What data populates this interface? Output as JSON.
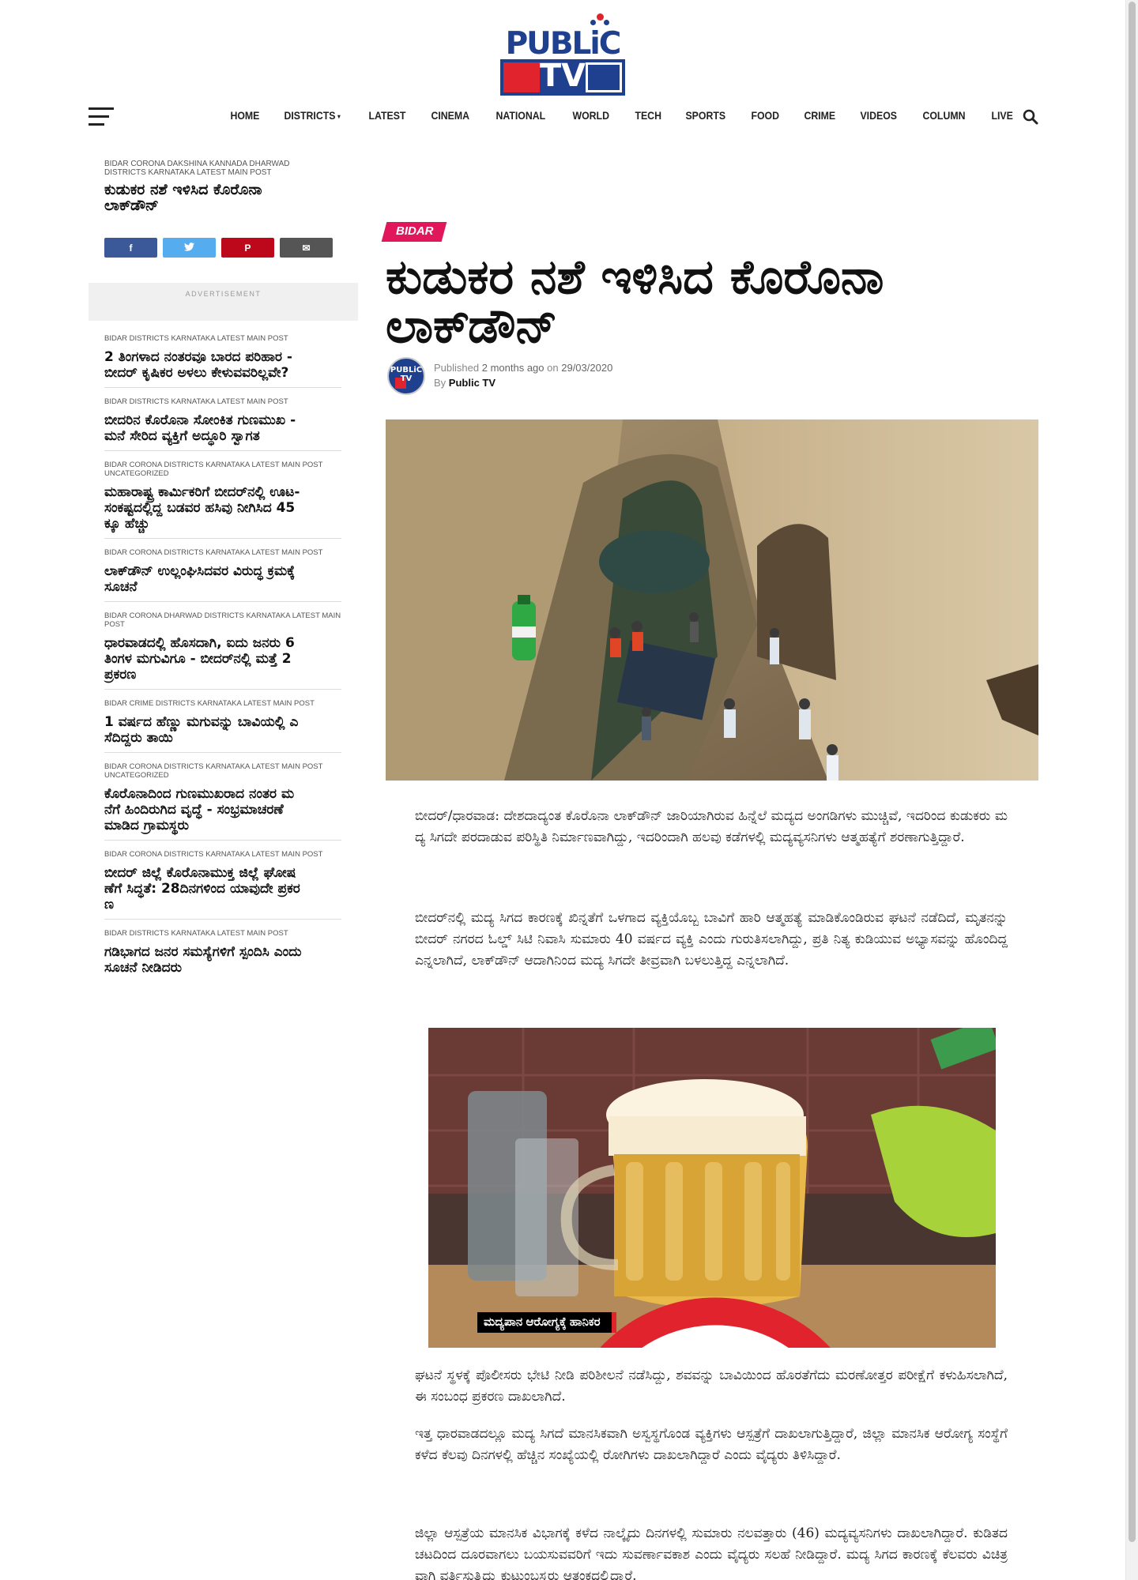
{
  "brand": {
    "logo_line1": "PUBLiC",
    "logo_line2": "TV",
    "colors": {
      "blue": "#1f3f8f",
      "red": "#e0232c",
      "accent_pink": "#e0175b"
    }
  },
  "nav": {
    "items": [
      "HOME",
      "DISTRICTS",
      "LATEST",
      "CINEMA",
      "NATIONAL",
      "WORLD",
      "TECH",
      "SPORTS",
      "FOOD",
      "CRIME",
      "VIDEOS",
      "COLUMN",
      "LIVE"
    ],
    "dropdown_indicator": "▾",
    "menu_icon": "hamburger-icon",
    "search_icon": "search-icon"
  },
  "sidebar": {
    "top_post": {
      "categories": "BIDAR CORONA DAKSHINA KANNADA DHARWAD DISTRICTS KARNATAKA LATEST MAIN POST",
      "title": "ಕುಡುಕರ ನಶೆ ಇಳಿಸಿದ ಕೊರೊನಾ ಲಾಕ್‍ಡೌನ್"
    },
    "share_buttons": [
      {
        "icon": "facebook-icon",
        "glyph": "f",
        "color": "#3b5998"
      },
      {
        "icon": "twitter-icon",
        "glyph": "🐦",
        "color": "#55acee"
      },
      {
        "icon": "pinterest-icon",
        "glyph": "P",
        "color": "#bd081c"
      },
      {
        "icon": "email-icon",
        "glyph": "✉",
        "color": "#555555"
      }
    ],
    "ad_label": "ADVERTISEMENT",
    "posts": [
      {
        "categories": "BIDAR DISTRICTS KARNATAKA LATEST MAIN POST",
        "title": "2 ತಿಂಗಳಾದ ನಂತರವೂ ಬಾರದ ಪರಿಹಾರ - ಬೀದರ್ ಕೃಷಿಕರ ಅಳಲು ಕೇಳುವವರಿಲ್ಲವೇ?"
      },
      {
        "categories": "BIDAR DISTRICTS KARNATAKA LATEST MAIN POST",
        "title": "ಬೀದರಿನ ಕೊರೊನಾ ಸೋಂಕಿತ ಗುಣಮುಖ - ಮನೆ ಸೇರಿದ ವ್ಯಕ್ತಿಗೆ ಅದ್ಧೂರಿ ಸ್ವಾಗತ"
      },
      {
        "categories": "BIDAR CORONA DISTRICTS KARNATAKA LATEST MAIN POST UNCATEGORIZED",
        "title": "ಮಹಾರಾಷ್ಟ್ರ ಕಾರ್ಮಿಕರಿಗೆ ಬೀದರ್‌ನಲ್ಲಿ ಊಟ- ಸಂಕಷ್ಟದಲ್ಲಿದ್ದ ಬಡವರ ಹಸಿವು ನೀಗಿಸಿದ 45ಕ್ಕೂ ಹೆಚ್ಚು"
      },
      {
        "categories": "BIDAR CORONA DISTRICTS KARNATAKA LATEST MAIN POST",
        "title": "ಲಾಕ್‍ಡೌನ್ ಉಲ್ಲಂಘಿಸಿದವರ ವಿರುದ್ಧ ಕ್ರಮಕ್ಕೆ ಸೂಚನೆ"
      },
      {
        "categories": "BIDAR CORONA DHARWAD DISTRICTS KARNATAKA LATEST MAIN POST",
        "title": "ಧಾರವಾಡದಲ್ಲಿ ಹೊಸದಾಗಿ, ಐದು ಜನರು 6 ತಿಂಗಳ ಮಗುವಿಗೂ - ಬೀದರ್‌ನಲ್ಲಿ ಮತ್ತೆ 2 ಪ್ರಕರಣ"
      },
      {
        "categories": "BIDAR CRIME DISTRICTS KARNATAKA LATEST MAIN POST",
        "title": "1 ವರ್ಷದ ಹೆಣ್ಣು ಮಗುವನ್ನು ಬಾವಿಯಲ್ಲಿ ಎಸೆದಿದ್ದರು ತಾಯಿ"
      },
      {
        "categories": "BIDAR CORONA DISTRICTS KARNATAKA LATEST MAIN POST UNCATEGORIZED",
        "title": "ಕೊರೊನಾದಿಂದ ಗುಣಮುಖರಾದ ನಂತರ ಮನೆಗೆ ಹಿಂದಿರುಗಿದ ವೃದ್ಧೆ - ಸಂಭ್ರಮಾಚರಣೆ ಮಾಡಿದ ಗ್ರಾಮಸ್ಥರು"
      },
      {
        "categories": "BIDAR CORONA DISTRICTS KARNATAKA LATEST MAIN POST",
        "title": "ಬೀದರ್ ಜಿಲ್ಲೆ ಕೊರೊನಾಮುಕ್ತ ಜಿಲ್ಲೆ ಘೋಷಣೆಗೆ ಸಿದ್ಧತೆ: 28ದಿನಗಳಿಂದ ಯಾವುದೇ ಪ್ರಕರಣ"
      },
      {
        "categories": "BIDAR DISTRICTS KARNATAKA LATEST MAIN POST",
        "title": "ಗಡಿಭಾಗದ ಜನರ ಸಮಸ್ಯೆಗಳಿಗೆ ಸ್ಪಂದಿಸಿ ಎಂದು ಸೂಚನೆ ನೀಡಿದರು"
      }
    ]
  },
  "article": {
    "category": "BIDAR",
    "title": "ಕುಡುಕರ ನಶೆ ಇಳಿಸಿದ ಕೊರೊನಾ ಲಾಕ್‍ಡೌನ್",
    "meta": {
      "published_label": "Published",
      "published_ago": "2 months ago",
      "on_label": "on",
      "date": "29/03/2020",
      "by_label": "By",
      "author": "Public TV"
    },
    "paragraphs": [
      "ಬೀದರ್/ಧಾರವಾಡ: ದೇಶದಾದ್ಯಂತ ಕೊರೊನಾ ಲಾಕ್‍ಡೌನ್ ಜಾರಿಯಾಗಿರುವ ಹಿನ್ನೆಲೆ ಮದ್ಯದ ಅಂಗಡಿಗಳು ಮುಚ್ಚಿವೆ, ಇದರಿಂದ ಕುಡುಕರು ಮದ್ಯ ಸಿಗದೇ ಪರದಾಡುವ ಪರಿಸ್ಥಿತಿ ನಿರ್ಮಾಣವಾಗಿದ್ದು, ಇದರಿಂದಾಗಿ ಹಲವು ಕಡೆಗಳಲ್ಲಿ ಮದ್ಯವ್ಯಸನಿಗಳು ಆತ್ಮಹತ್ಯೆಗೆ ಶರಣಾಗುತ್ತಿದ್ದಾರೆ.",
      "ಬೀದರ್‌ನಲ್ಲಿ ಮದ್ಯ ಸಿಗದ ಕಾರಣಕ್ಕೆ ಖಿನ್ನತೆಗೆ ಒಳಗಾದ ವ್ಯಕ್ತಿಯೊಬ್ಬ ಬಾವಿಗೆ ಹಾರಿ ಆತ್ಮಹತ್ಯೆ ಮಾಡಿಕೊಂಡಿರುವ ಘಟನೆ ನಡೆದಿದೆ, ಮೃತನನ್ನು ಬೀದರ್ ನಗರದ ಓಲ್ಡ್ ಸಿಟಿ ನಿವಾಸಿ ಸುಮಾರು 40 ವರ್ಷದ ವ್ಯಕ್ತಿ ಎಂದು ಗುರುತಿಸಲಾಗಿದ್ದು, ಪ್ರತಿ ನಿತ್ಯ ಕುಡಿಯುವ ಅಭ್ಯಾಸವನ್ನು ಹೊಂದಿದ್ದ ಎನ್ನಲಾಗಿದೆ, ಲಾಕ್‍ಡೌನ್ ಆದಾಗಿನಿಂದ ಮದ್ಯ ಸಿಗದೇ ತೀವ್ರವಾಗಿ ಬಳಲುತ್ತಿದ್ದ ಎನ್ನಲಾಗಿದೆ.",
      "ಘಟನೆ ಸ್ಥಳಕ್ಕೆ ಪೊಲೀಸರು ಭೇಟಿ ನೀಡಿ ಪರಿಶೀಲನೆ ನಡೆಸಿದ್ದು, ಶವವನ್ನು ಬಾವಿಯಿಂದ ಹೊರತೆಗೆದು ಮರಣೋತ್ತರ ಪರೀಕ್ಷೆಗೆ ಕಳುಹಿಸಲಾಗಿದೆ, ಈ ಸಂಬಂಧ ಪ್ರಕರಣ ದಾಖಲಾಗಿದೆ.",
      "ಇತ್ತ ಧಾರವಾಡದಲ್ಲೂ ಮದ್ಯ ಸಿಗದೆ ಮಾನಸಿಕವಾಗಿ ಅಸ್ವಸ್ಥಗೊಂಡ ವ್ಯಕ್ತಿಗಳು ಆಸ್ಪತ್ರೆಗೆ ದಾಖಲಾಗುತ್ತಿದ್ದಾರೆ, ಜಿಲ್ಲಾ ಮಾನಸಿಕ ಆರೋಗ್ಯ ಸಂಸ್ಥೆಗೆ ಕಳೆದ ಕೆಲವು ದಿನಗಳಲ್ಲಿ ಹೆಚ್ಚಿನ ಸಂಖ್ಯೆಯಲ್ಲಿ ರೋಗಿಗಳು ದಾಖಲಾಗಿದ್ದಾರೆ ಎಂದು ವೈದ್ಯರು ತಿಳಿಸಿದ್ದಾರೆ.",
      "ಜಿಲ್ಲಾ ಆಸ್ಪತ್ರೆಯ ಮಾನಸಿಕ ವಿಭಾಗಕ್ಕೆ ಕಳೆದ ನಾಲ್ಕೈದು ದಿನಗಳಲ್ಲಿ ಸುಮಾರು ನಲವತ್ತಾರು (46) ಮದ್ಯವ್ಯಸನಿಗಳು ದಾಖಲಾಗಿದ್ದಾರೆ. ಕುಡಿತದ ಚಟದಿಂದ ದೂರವಾಗಲು ಬಯಸುವವರಿಗೆ ಇದು ಸುವರ್ಣಾವಕಾಶ ಎಂದು ವೈದ್ಯರು ಸಲಹೆ ನೀಡಿದ್ದಾರೆ. ಮದ್ಯ ಸಿಗದ ಕಾರಣಕ್ಕೆ ಕೆಲವರು ವಿಚಿತ್ರವಾಗಿ ವರ್ತಿಸುತ್ತಿದ್ದು ಕುಟುಂಬಸ್ಥರು ಆತಂಕದಲ್ಲಿದ್ದಾರೆ."
    ],
    "hero_image_icon": "well-rescue-photo",
    "inline_image_icon": "beer-mug-photo",
    "inline_image_caption": "ಮದ್ಯಪಾನ ಆರೋಗ್ಯಕ್ಕೆ ಹಾನಿಕರ"
  }
}
